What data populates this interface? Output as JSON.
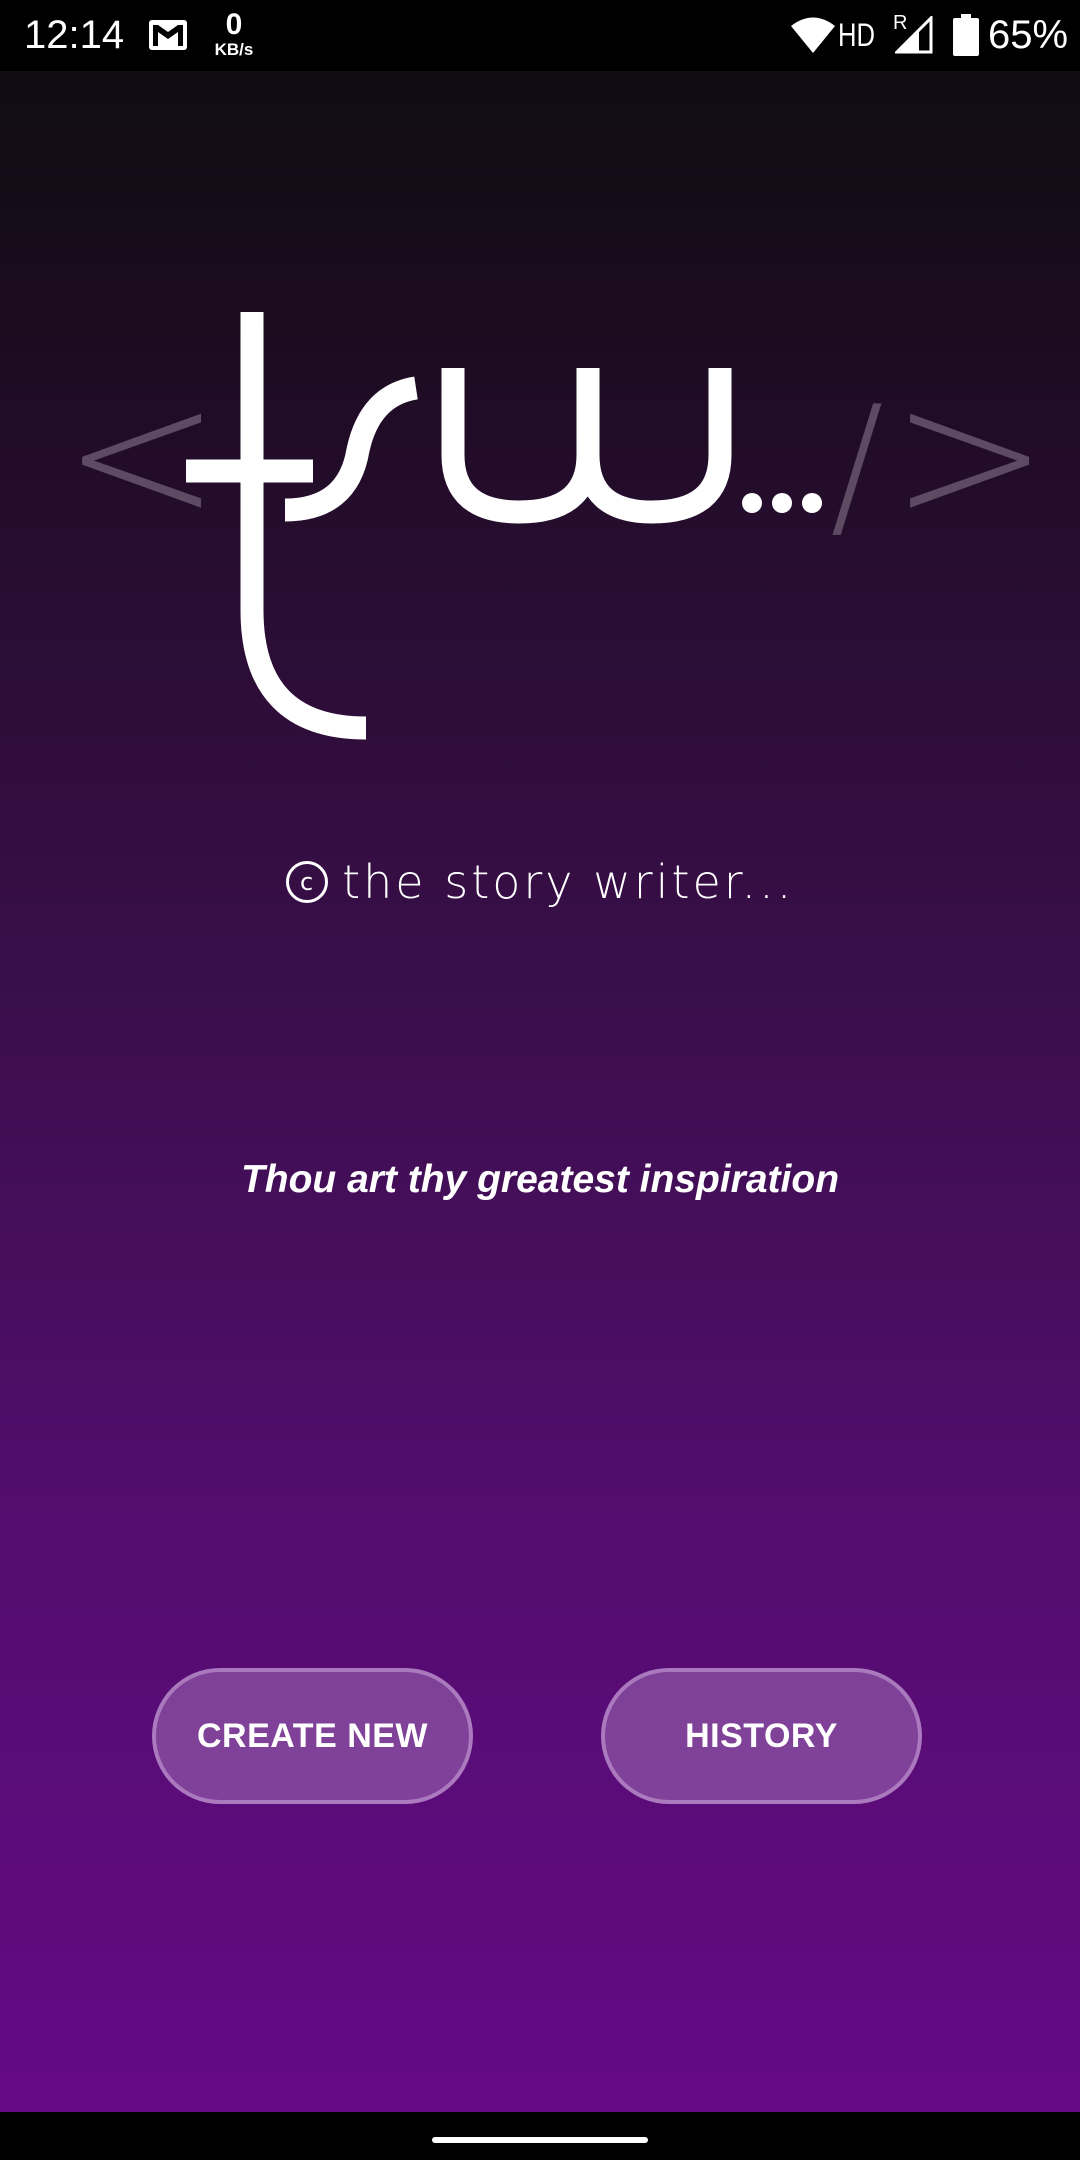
{
  "status_bar": {
    "time": "12:14",
    "net_speed_value": "0",
    "net_speed_unit": "KB/s",
    "network_type": "HD",
    "roaming": "R",
    "battery_percent": "65%",
    "icons": [
      "gmail-icon",
      "wifi-icon",
      "signal-icon",
      "battery-icon"
    ]
  },
  "logo": {
    "open_bracket": "<",
    "letters": "trw",
    "ellipsis": "...",
    "close_slash": "/",
    "close_bracket": ">",
    "text_color": "#ffffff",
    "bracket_color": "#5e4a63"
  },
  "copyright": {
    "symbol": "c",
    "text": "the story writer..."
  },
  "tagline": "Thou art thy greatest inspiration",
  "buttons": {
    "create_new": "CREATE NEW",
    "history": "HISTORY"
  },
  "colors": {
    "background_top": "#100c12",
    "background_bottom": "#640a85",
    "button_fill": "#8a5a9e",
    "button_border": "#b894c6"
  }
}
